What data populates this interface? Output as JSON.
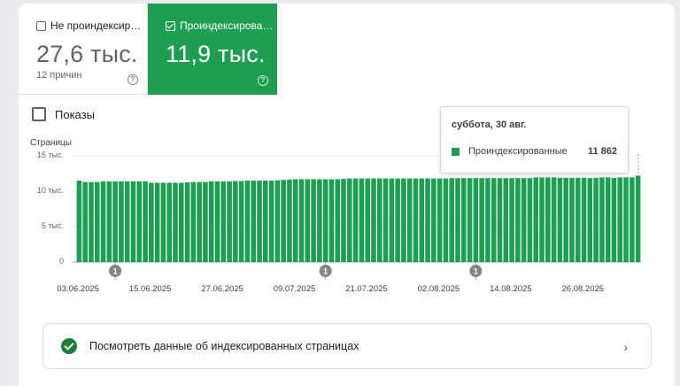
{
  "tiles": {
    "not_indexed": {
      "label": "Не проиндексир…",
      "value": "27,6 тыс.",
      "sub": "12 причин",
      "checked": false
    },
    "indexed": {
      "label": "Проиндексирова…",
      "value": "11,9 тыс.",
      "checked": true,
      "color": "#1e9e52"
    }
  },
  "shows_label": "Показы",
  "tooltip": {
    "title": "суббота, 30 авг.",
    "series": "Проиндексированные",
    "value": "11 862"
  },
  "link_card": {
    "label": "Посмотреть данные об индексированных страницах"
  },
  "chart_data": {
    "type": "bar",
    "ylabel": "Страницы",
    "ylim": [
      0,
      15000
    ],
    "yticks": [
      "15 тыс.",
      "10 тыс.",
      "5 тыс.",
      "0"
    ],
    "ytick_values": [
      15000,
      10000,
      5000,
      0
    ],
    "xticks": [
      "03.06.2025",
      "15.06.2025",
      "27.06.2025",
      "09.07.2025",
      "21.07.2025",
      "02.08.2025",
      "14.08.2025",
      "26.08.2025"
    ],
    "annotations": [
      {
        "label": "1",
        "date": "09.06.2025"
      },
      {
        "label": "1",
        "date": "14.07.2025"
      },
      {
        "label": "1",
        "date": "08.08.2025"
      }
    ],
    "color": "#1e9e52",
    "series": [
      {
        "name": "Проиндексированные",
        "x_start": "03.06.2025",
        "x_end": "30.08.2025",
        "values": [
          11500,
          11300,
          11300,
          11300,
          11400,
          11400,
          11400,
          11400,
          11400,
          11400,
          11400,
          11400,
          11200,
          11200,
          11200,
          11200,
          11200,
          11200,
          11250,
          11300,
          11300,
          11300,
          11400,
          11400,
          11400,
          11400,
          11450,
          11450,
          11500,
          11500,
          11500,
          11500,
          11500,
          11550,
          11600,
          11650,
          11700,
          11700,
          11700,
          11700,
          11700,
          11700,
          11700,
          11700,
          11750,
          11800,
          11800,
          11800,
          11800,
          11800,
          11800,
          11800,
          11800,
          11800,
          11800,
          11800,
          11800,
          11800,
          11800,
          11800,
          11800,
          11800,
          11850,
          11850,
          11850,
          11850,
          11850,
          11850,
          11850,
          11850,
          11850,
          11850,
          11850,
          11850,
          11850,
          11850,
          11950,
          11950,
          11950,
          11950,
          11900,
          11900,
          11900,
          11900,
          11900,
          11850,
          11900,
          11950,
          11950,
          11900,
          11950,
          11950,
          11950,
          12200
        ]
      }
    ]
  }
}
